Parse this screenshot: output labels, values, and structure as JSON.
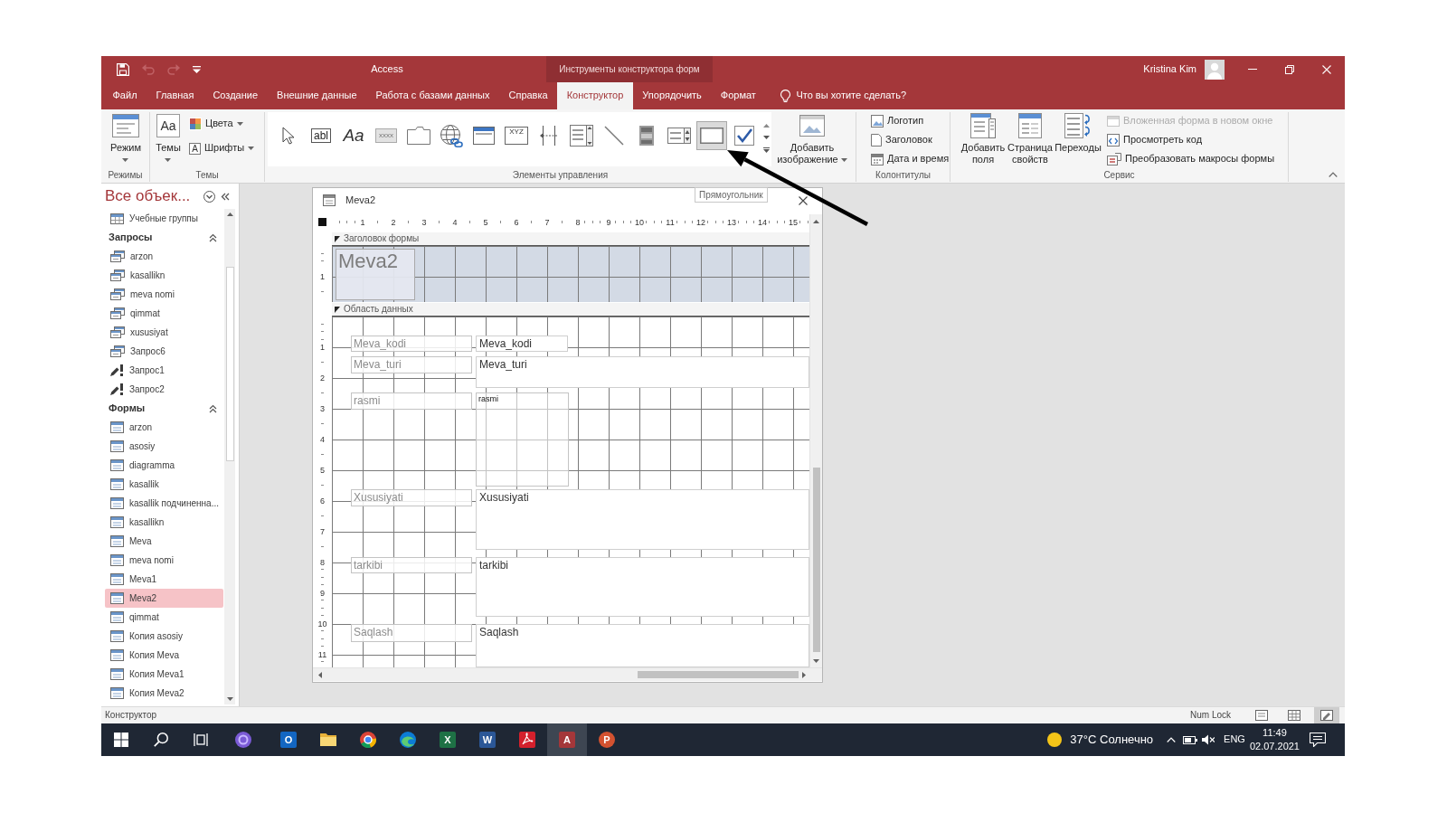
{
  "window": {
    "title": "Access",
    "context_title": "Инструменты конструктора форм",
    "user": "Kristina Kim"
  },
  "quick_access": [
    {
      "kind": "save",
      "disabled": false
    },
    {
      "kind": "undo",
      "disabled": true
    },
    {
      "kind": "redo",
      "disabled": true
    },
    {
      "kind": "customize",
      "disabled": false
    }
  ],
  "ribbon_tabs": [
    {
      "label": "Файл",
      "selected": false
    },
    {
      "label": "Главная",
      "selected": false
    },
    {
      "label": "Создание",
      "selected": false
    },
    {
      "label": "Внешние данные",
      "selected": false
    },
    {
      "label": "Работа с базами данных",
      "selected": false
    },
    {
      "label": "Справка",
      "selected": false
    },
    {
      "label": "Конструктор",
      "selected": true
    },
    {
      "label": "Упорядочить",
      "selected": false
    },
    {
      "label": "Формат",
      "selected": false
    }
  ],
  "tell_me": {
    "placeholder": "Что вы хотите сделать?"
  },
  "ribbon_groups": [
    {
      "label": "Режимы",
      "items": [
        {
          "kind": "view",
          "label": "Режим",
          "dropdown": true
        }
      ]
    },
    {
      "label": "Темы",
      "items": [
        {
          "kind": "themes",
          "label": "Темы",
          "glyph": "Aa",
          "dropdown": true
        },
        {
          "kind": "colors",
          "label": "Цвета",
          "dropdown": true
        },
        {
          "kind": "fonts",
          "label": "Шрифты",
          "glyph": "A",
          "dropdown": true
        }
      ]
    },
    {
      "label": "Элементы управления",
      "items": [
        {
          "kind": "gallery",
          "tools": [
            {
              "kind": "pointer"
            },
            {
              "kind": "textbox",
              "glyph": "abl"
            },
            {
              "kind": "label",
              "glyph": "Aa"
            },
            {
              "kind": "button",
              "glyph": "xxxx"
            },
            {
              "kind": "tab"
            },
            {
              "kind": "hyperlink"
            },
            {
              "kind": "browser"
            },
            {
              "kind": "optiongroup",
              "glyph": "XYZ"
            },
            {
              "kind": "pagebreak"
            },
            {
              "kind": "combobox"
            },
            {
              "kind": "line"
            },
            {
              "kind": "toggle"
            },
            {
              "kind": "listbox"
            },
            {
              "kind": "rectangle",
              "tooltip": "Прямоугольник"
            },
            {
              "kind": "checkbox"
            }
          ]
        },
        {
          "kind": "image",
          "label": "Добавить изображение",
          "dropdown": true
        }
      ]
    },
    {
      "label": "Колонтитулы",
      "items": [
        {
          "kind": "logo",
          "label": "Логотип"
        },
        {
          "kind": "title",
          "label": "Заголовок"
        },
        {
          "kind": "datetime",
          "label": "Дата и время"
        }
      ]
    },
    {
      "label": "Сервис",
      "items": [
        {
          "kind": "addfields",
          "label": "Добавить поля"
        },
        {
          "kind": "propsheet",
          "label": "Страница свойств"
        },
        {
          "kind": "taborder",
          "label": "Переходы"
        },
        {
          "kind": "subform",
          "label": "Вложенная форма в новом окне",
          "disabled": true
        },
        {
          "kind": "code",
          "label": "Просмотреть код",
          "disabled": false
        },
        {
          "kind": "convert",
          "label": "Преобразовать макросы формы",
          "disabled": false
        }
      ]
    }
  ],
  "navigation": {
    "title": "Все объек...",
    "groups": [
      {
        "items": [
          {
            "label": "Учебные группы",
            "kind": "table",
            "selected": false
          }
        ]
      },
      {
        "title": "Запросы",
        "expanded": true,
        "items": [
          {
            "label": "arzon",
            "kind": "query",
            "selected": false
          },
          {
            "label": "kasallikn",
            "kind": "query",
            "selected": false
          },
          {
            "label": "meva nomi",
            "kind": "query",
            "selected": false
          },
          {
            "label": "qimmat",
            "kind": "query",
            "selected": false
          },
          {
            "label": "xususiyat",
            "kind": "query",
            "selected": false
          },
          {
            "label": "Запрос6",
            "kind": "query",
            "selected": false
          },
          {
            "label": "Запрос1",
            "kind": "action",
            "selected": false
          },
          {
            "label": "Запрос2",
            "kind": "action",
            "selected": false
          }
        ]
      },
      {
        "title": "Формы",
        "expanded": true,
        "items": [
          {
            "label": "arzon",
            "kind": "form",
            "selected": false
          },
          {
            "label": "asosiy",
            "kind": "form",
            "selected": false
          },
          {
            "label": "diagramma",
            "kind": "form",
            "selected": false
          },
          {
            "label": "kasallik",
            "kind": "form",
            "selected": false
          },
          {
            "label": "kasallik подчиненна...",
            "kind": "form",
            "selected": false
          },
          {
            "label": "kasallikn",
            "kind": "form",
            "selected": false
          },
          {
            "label": "Meva",
            "kind": "form",
            "selected": false
          },
          {
            "label": "meva nomi",
            "kind": "form",
            "selected": false
          },
          {
            "label": "Meva1",
            "kind": "form",
            "selected": false
          },
          {
            "label": "Meva2",
            "kind": "form",
            "selected": true
          },
          {
            "label": "qimmat",
            "kind": "form",
            "selected": false
          },
          {
            "label": "Копия asosiy",
            "kind": "form",
            "selected": false
          },
          {
            "label": "Копия Meva",
            "kind": "form",
            "selected": false
          },
          {
            "label": "Копия Meva1",
            "kind": "form",
            "selected": false
          },
          {
            "label": "Копия Meva2",
            "kind": "form",
            "selected": false
          }
        ]
      }
    ]
  },
  "document": {
    "title": "Meva2",
    "ruler": [
      "1",
      "2",
      "3",
      "4",
      "5",
      "6",
      "7",
      "8",
      "9",
      "10",
      "11",
      "12",
      "13",
      "14",
      "15"
    ],
    "sections": [
      {
        "kind": "header",
        "title": "Заголовок формы",
        "ruler": [
          "1"
        ],
        "label": "Meva2"
      },
      {
        "kind": "detail",
        "title": "Область данных",
        "ruler": [
          "1",
          "2",
          "3",
          "4",
          "5",
          "6",
          "7",
          "8",
          "9",
          "10",
          "11"
        ],
        "fields": [
          {
            "label": "Meva_kodi",
            "control": "Meva_kodi",
            "kind": "textbox"
          },
          {
            "label": "Meva_turi",
            "control": "Meva_turi",
            "kind": "textbox"
          },
          {
            "label": "rasmi",
            "control": "rasmi",
            "kind": "image"
          },
          {
            "label": "Xususiyati",
            "control": "Xususiyati",
            "kind": "textbox"
          },
          {
            "label": "tarkibi",
            "control": "tarkibi",
            "kind": "textbox"
          },
          {
            "label": "Saqlash",
            "control": "Saqlash",
            "kind": "textbox"
          }
        ]
      }
    ]
  },
  "status_bar": {
    "text": "Конструктор",
    "indicator": "Num Lock",
    "views": [
      {
        "kind": "form",
        "selected": false
      },
      {
        "kind": "layout",
        "selected": false
      },
      {
        "kind": "design",
        "selected": true
      }
    ]
  },
  "taskbar": {
    "buttons": [
      {
        "kind": "start"
      },
      {
        "kind": "search"
      },
      {
        "kind": "taskview"
      }
    ],
    "apps": [
      {
        "kind": "ring",
        "active": false
      },
      {
        "kind": "mail",
        "glyph": "O",
        "active": false
      },
      {
        "kind": "folder",
        "active": false
      },
      {
        "kind": "wheel",
        "active": false
      },
      {
        "kind": "wave",
        "active": false
      },
      {
        "kind": "sheet",
        "glyph": "X",
        "active": false
      },
      {
        "kind": "doc",
        "glyph": "W",
        "active": false
      },
      {
        "kind": "pdf",
        "active": false
      },
      {
        "kind": "database",
        "glyph": "A",
        "active": true
      },
      {
        "kind": "slides",
        "glyph": "P",
        "active": false
      }
    ],
    "weather": "37°C Солнечно",
    "language": "ENG",
    "time": "11:49",
    "date": "02.07.2021"
  }
}
